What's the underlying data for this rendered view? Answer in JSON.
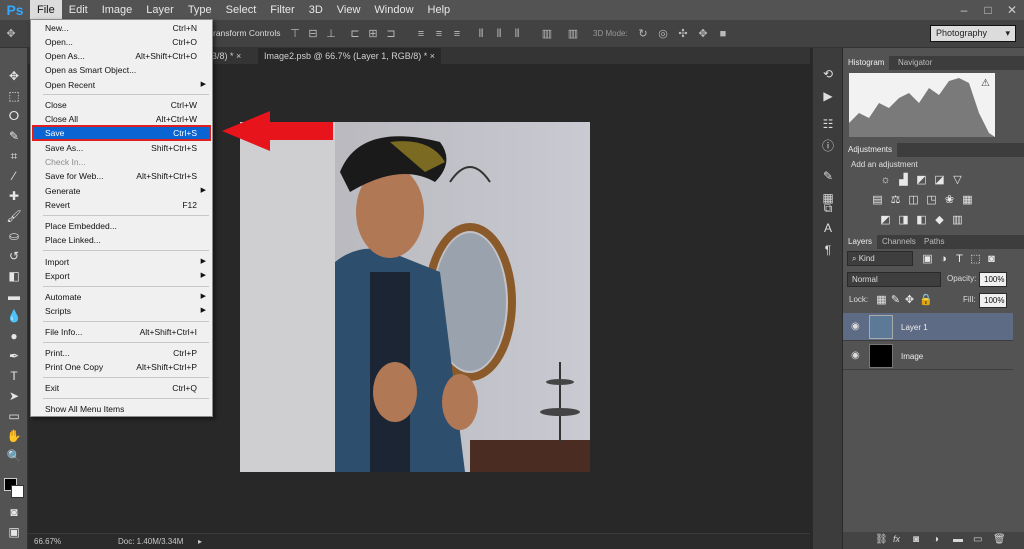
{
  "app": {
    "logo": "Ps"
  },
  "menubar": {
    "items": [
      "File",
      "Edit",
      "Image",
      "Layer",
      "Type",
      "Select",
      "Filter",
      "3D",
      "View",
      "Window",
      "Help"
    ],
    "window_controls": [
      "–",
      "□",
      "✕"
    ]
  },
  "options_bar": {
    "transform_label": "ransform Controls",
    "mode_label": "3D Mode:",
    "workspace": "Photography"
  },
  "tabs": [
    {
      "label": "GB/8) *"
    },
    {
      "label": "Image2.psb @ 66.7% (Layer 1, RGB/8) *"
    }
  ],
  "file_menu": {
    "items": [
      {
        "label": "New...",
        "shortcut": "Ctrl+N",
        "sub": false,
        "disabled": false
      },
      {
        "label": "Open...",
        "shortcut": "Ctrl+O",
        "sub": false,
        "disabled": false
      },
      {
        "label": "Open As...",
        "shortcut": "Alt+Shift+Ctrl+O",
        "sub": false,
        "disabled": false
      },
      {
        "label": "Open as Smart Object...",
        "shortcut": "",
        "sub": false,
        "disabled": false
      },
      {
        "label": "Open Recent",
        "shortcut": "",
        "sub": true,
        "disabled": false
      },
      {
        "label": "Close",
        "shortcut": "Ctrl+W",
        "sub": false,
        "disabled": false
      },
      {
        "label": "Close All",
        "shortcut": "Alt+Ctrl+W",
        "sub": false,
        "disabled": false
      },
      {
        "label": "Save",
        "shortcut": "Ctrl+S",
        "sub": false,
        "disabled": false,
        "highlighted": true
      },
      {
        "label": "Save As...",
        "shortcut": "Shift+Ctrl+S",
        "sub": false,
        "disabled": false
      },
      {
        "label": "Check In...",
        "shortcut": "",
        "sub": false,
        "disabled": true
      },
      {
        "label": "Save for Web...",
        "shortcut": "Alt+Shift+Ctrl+S",
        "sub": false,
        "disabled": false
      },
      {
        "label": "Generate",
        "shortcut": "",
        "sub": true,
        "disabled": false
      },
      {
        "label": "Revert",
        "shortcut": "F12",
        "sub": false,
        "disabled": false
      },
      {
        "label": "Place Embedded...",
        "shortcut": "",
        "sub": false,
        "disabled": false
      },
      {
        "label": "Place Linked...",
        "shortcut": "",
        "sub": false,
        "disabled": false
      },
      {
        "label": "Import",
        "shortcut": "",
        "sub": true,
        "disabled": false
      },
      {
        "label": "Export",
        "shortcut": "",
        "sub": true,
        "disabled": false
      },
      {
        "label": "Automate",
        "shortcut": "",
        "sub": true,
        "disabled": false
      },
      {
        "label": "Scripts",
        "shortcut": "",
        "sub": true,
        "disabled": false
      },
      {
        "label": "File Info...",
        "shortcut": "Alt+Shift+Ctrl+I",
        "sub": false,
        "disabled": false
      },
      {
        "label": "Print...",
        "shortcut": "Ctrl+P",
        "sub": false,
        "disabled": false
      },
      {
        "label": "Print One Copy",
        "shortcut": "Alt+Shift+Ctrl+P",
        "sub": false,
        "disabled": false
      },
      {
        "label": "Exit",
        "shortcut": "Ctrl+Q",
        "sub": false,
        "disabled": false
      },
      {
        "label": "Show All Menu Items",
        "shortcut": "",
        "sub": false,
        "disabled": false
      }
    ]
  },
  "status": {
    "zoom": "66.67%",
    "doc": "Doc: 1.40M/3.34M"
  },
  "panels": {
    "histogram_tabs": [
      "Histogram",
      "Navigator"
    ],
    "adjustments_title": "Adjustments",
    "adjustments_hint": "Add an adjustment",
    "layers_tabs": [
      "Layers",
      "Channels",
      "Paths"
    ],
    "kind": "Kind",
    "blend_mode": "Normal",
    "opacity_label": "Opacity:",
    "opacity_value": "100%",
    "lock_label": "Lock:",
    "fill_label": "Fill:",
    "fill_value": "100%",
    "layers": [
      {
        "name": "Layer 1",
        "selected": true
      },
      {
        "name": "Image",
        "selected": false
      }
    ]
  },
  "colors": {
    "accent": "#0a64d2",
    "arrow": "#e8141b",
    "highlight_border": "#e0201f"
  }
}
